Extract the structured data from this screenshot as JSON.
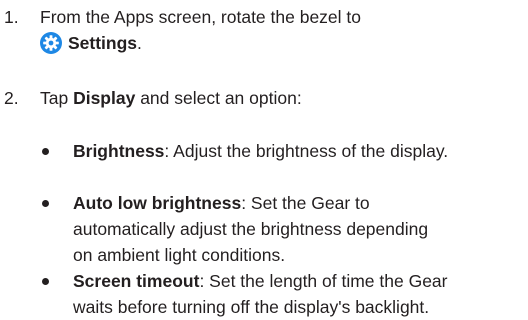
{
  "steps": [
    {
      "number": "1.",
      "text_line1": "From the Apps screen, rotate the bezel to",
      "icon": "settings-gear-icon",
      "icon_color": "#1e88e5",
      "link": "Settings",
      "trailing": "."
    },
    {
      "number": "2.",
      "prefix": "Tap ",
      "bold": "Display",
      "suffix": " and select an option:"
    }
  ],
  "options": [
    {
      "term": "Brightness",
      "line1": ": Adjust the brightness of the display."
    },
    {
      "term": "Auto low brightness",
      "line1": ": Set the Gear to",
      "line2": "automatically adjust the brightness depending",
      "line3": "on ambient light conditions."
    },
    {
      "term": "Screen timeout",
      "line1": ": Set the length of time the Gear",
      "line2": "waits before turning off the display's backlight."
    }
  ]
}
